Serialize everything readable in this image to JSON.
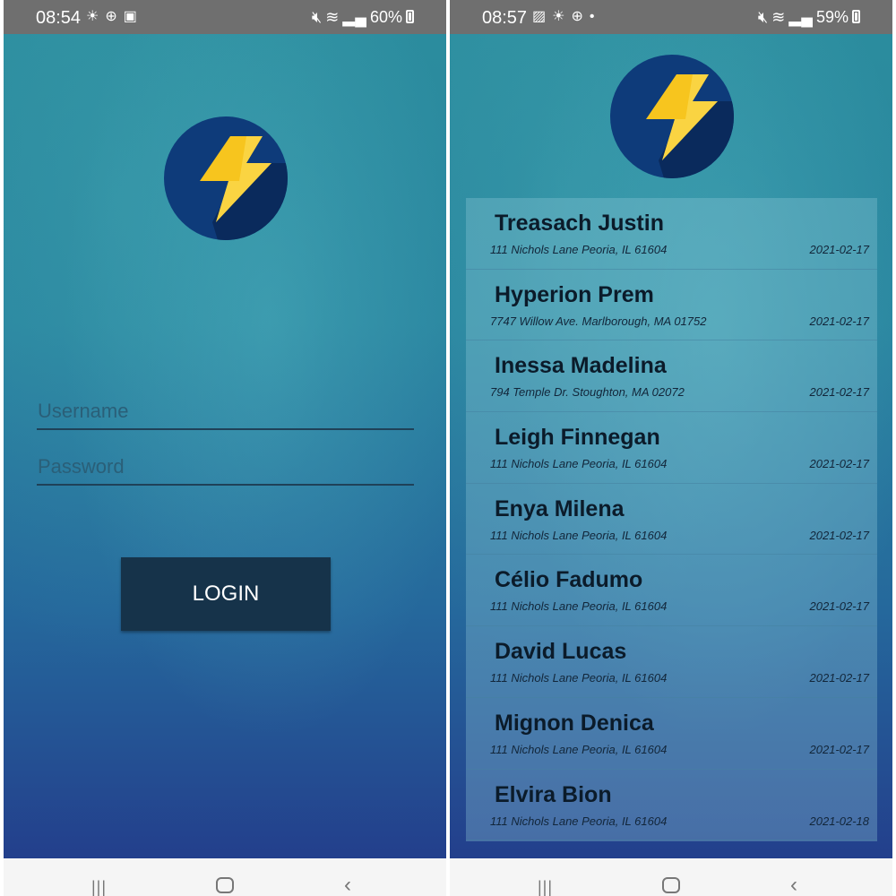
{
  "left_screen": {
    "status_bar": {
      "time": "08:54",
      "notification_icons": [
        "brightness-icon",
        "vpn-icon",
        "app-notification-icon"
      ],
      "battery": "60%"
    },
    "login_form": {
      "username_placeholder": "Username",
      "password_placeholder": "Password",
      "login_label": "LOGIN"
    }
  },
  "right_screen": {
    "status_bar": {
      "time": "08:57",
      "notification_icons": [
        "image-icon",
        "brightness-icon",
        "vpn-icon",
        "dot-icon"
      ],
      "battery": "59%"
    },
    "list": [
      {
        "name": "Treasach Justin",
        "address": "111 Nichols Lane Peoria, IL 61604",
        "date": "2021-02-17"
      },
      {
        "name": "Hyperion Prem",
        "address": "7747 Willow Ave. Marlborough, MA 01752",
        "date": "2021-02-17"
      },
      {
        "name": "Inessa Madelina",
        "address": "794 Temple Dr. Stoughton, MA 02072",
        "date": "2021-02-17"
      },
      {
        "name": "Leigh Finnegan",
        "address": "111 Nichols Lane Peoria, IL 61604",
        "date": "2021-02-17"
      },
      {
        "name": "Enya Milena",
        "address": "111 Nichols Lane Peoria, IL 61604",
        "date": "2021-02-17"
      },
      {
        "name": "Célio Fadumo",
        "address": "111 Nichols Lane Peoria, IL 61604",
        "date": "2021-02-17"
      },
      {
        "name": "David Lucas",
        "address": "111 Nichols Lane Peoria, IL 61604",
        "date": "2021-02-17"
      },
      {
        "name": "Mignon Denica",
        "address": "111 Nichols Lane Peoria, IL 61604",
        "date": "2021-02-17"
      },
      {
        "name": "Elvira Bion",
        "address": "111 Nichols Lane Peoria, IL 61604",
        "date": "2021-02-18"
      }
    ]
  },
  "colors": {
    "logo_circle": "#0e3b7a",
    "logo_bolt": "#f7c51e",
    "login_button": "#16334a"
  }
}
